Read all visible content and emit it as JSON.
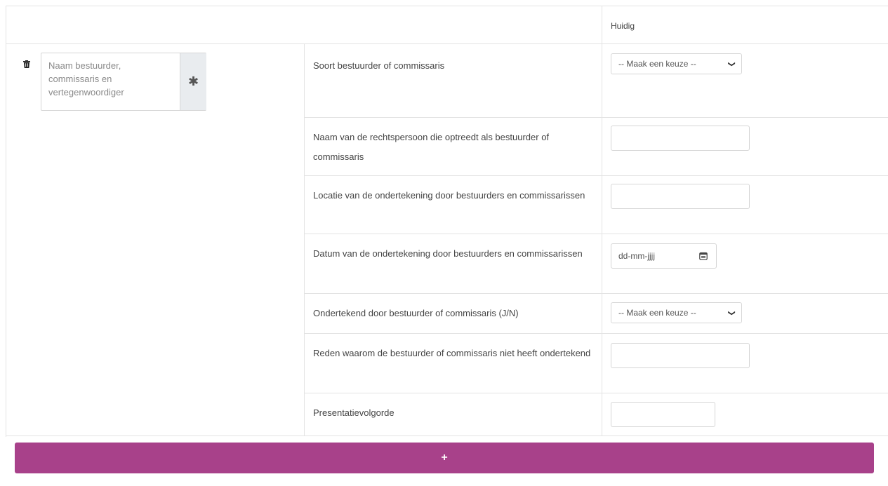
{
  "header": {
    "column_title": "Huidig"
  },
  "entry": {
    "name_placeholder": "Naam bestuurder, commissaris en vertegenwoordiger",
    "required_icon": "asterisk-icon",
    "delete_icon": "trash-icon"
  },
  "fields": [
    {
      "label": "Soort bestuurder of commissaris",
      "control": "select",
      "value": "-- Maak een keuze --"
    },
    {
      "label": "Naam van de rechtspersoon die optreedt als bestuurder of commissaris",
      "control": "text",
      "value": ""
    },
    {
      "label": "Locatie van de ondertekening door bestuurders en commissarissen",
      "control": "text",
      "value": ""
    },
    {
      "label": "Datum van de ondertekening door bestuurders en commissarissen",
      "control": "date",
      "placeholder": "dd-mm-jjjj"
    },
    {
      "label": "Ondertekend door bestuurder of commissaris (J/N)",
      "control": "select",
      "value": "-- Maak een keuze --"
    },
    {
      "label": "Reden waarom de bestuurder of commissaris niet heeft ondertekend",
      "control": "text",
      "value": ""
    },
    {
      "label": "Presentatievolgorde",
      "control": "text",
      "value": ""
    }
  ],
  "add_button": {
    "label": "+",
    "color": "#a8418a"
  }
}
